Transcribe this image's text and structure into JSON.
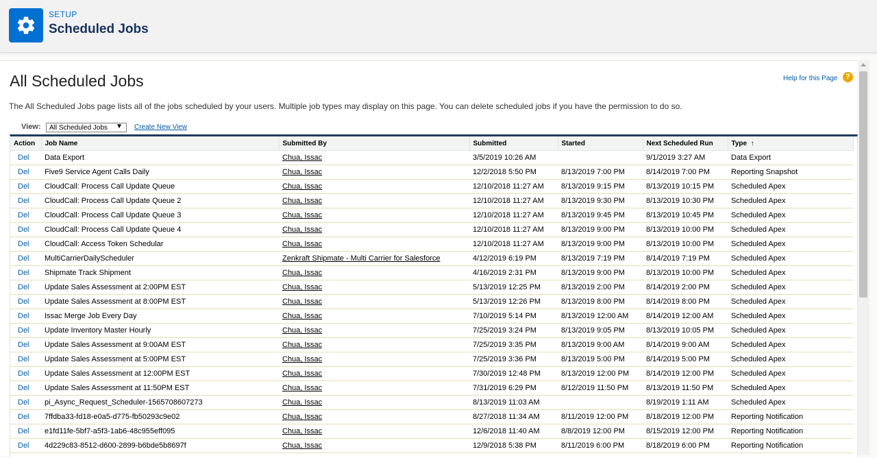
{
  "header": {
    "eyebrow": "SETUP",
    "title": "Scheduled Jobs"
  },
  "page": {
    "title": "All Scheduled Jobs",
    "help_link": "Help for this Page",
    "help_icon": "?",
    "description": "The All Scheduled Jobs page lists all of the jobs scheduled by your users. Multiple job types may display on this page. You can delete scheduled jobs if you have the permission to do so."
  },
  "view": {
    "label": "View:",
    "selected": "All Scheduled Jobs",
    "create_link": "Create New View"
  },
  "table": {
    "columns": {
      "action": "Action",
      "job_name": "Job Name",
      "submitted_by": "Submitted By",
      "submitted": "Submitted",
      "started": "Started",
      "next_run": "Next Scheduled Run",
      "type": "Type",
      "sort_indicator": "↑"
    },
    "rows": [
      {
        "action": "Del",
        "job_name": "Data Export",
        "submitted_by": "Chua, Issac",
        "submitted": "3/5/2019 10:26 AM",
        "started": "",
        "next_run": "9/1/2019 3:27 AM",
        "type": "Data Export"
      },
      {
        "action": "Del",
        "job_name": "Five9 Service Agent Calls Daily",
        "submitted_by": "Chua, Issac",
        "submitted": "12/2/2018 5:50 PM",
        "started": "8/13/2019 7:00 PM",
        "next_run": "8/14/2019 7:00 PM",
        "type": "Reporting Snapshot"
      },
      {
        "action": "Del",
        "job_name": "CloudCall: Process Call Update Queue",
        "submitted_by": "Chua, Issac",
        "submitted": "12/10/2018 11:27 AM",
        "started": "8/13/2019 9:15 PM",
        "next_run": "8/13/2019 10:15 PM",
        "type": "Scheduled Apex"
      },
      {
        "action": "Del",
        "job_name": "CloudCall: Process Call Update Queue 2",
        "submitted_by": "Chua, Issac",
        "submitted": "12/10/2018 11:27 AM",
        "started": "8/13/2019 9:30 PM",
        "next_run": "8/13/2019 10:30 PM",
        "type": "Scheduled Apex"
      },
      {
        "action": "Del",
        "job_name": "CloudCall: Process Call Update Queue 3",
        "submitted_by": "Chua, Issac",
        "submitted": "12/10/2018 11:27 AM",
        "started": "8/13/2019 9:45 PM",
        "next_run": "8/13/2019 10:45 PM",
        "type": "Scheduled Apex"
      },
      {
        "action": "Del",
        "job_name": "CloudCall: Process Call Update Queue 4",
        "submitted_by": "Chua, Issac",
        "submitted": "12/10/2018 11:27 AM",
        "started": "8/13/2019 9:00 PM",
        "next_run": "8/13/2019 10:00 PM",
        "type": "Scheduled Apex"
      },
      {
        "action": "Del",
        "job_name": "CloudCall: Access Token Schedular",
        "submitted_by": "Chua, Issac",
        "submitted": "12/10/2018 11:27 AM",
        "started": "8/13/2019 9:00 PM",
        "next_run": "8/13/2019 10:00 PM",
        "type": "Scheduled Apex"
      },
      {
        "action": "Del",
        "job_name": "MultiCarrierDailyScheduler",
        "submitted_by": "Zenkraft Shipmate - Multi Carrier for Salesforce",
        "submitted": "4/12/2019 6:19 PM",
        "started": "8/13/2019 7:19 PM",
        "next_run": "8/14/2019 7:19 PM",
        "type": "Scheduled Apex"
      },
      {
        "action": "Del",
        "job_name": "Shipmate Track Shipment",
        "submitted_by": "Chua, Issac",
        "submitted": "4/16/2019 2:31 PM",
        "started": "8/13/2019 9:00 PM",
        "next_run": "8/13/2019 10:00 PM",
        "type": "Scheduled Apex"
      },
      {
        "action": "Del",
        "job_name": "Update Sales Assessment at 2:00PM EST",
        "submitted_by": "Chua, Issac",
        "submitted": "5/13/2019 12:25 PM",
        "started": "8/13/2019 2:00 PM",
        "next_run": "8/14/2019 2:00 PM",
        "type": "Scheduled Apex"
      },
      {
        "action": "Del",
        "job_name": "Update Sales Assessment at 8:00PM EST",
        "submitted_by": "Chua, Issac",
        "submitted": "5/13/2019 12:26 PM",
        "started": "8/13/2019 8:00 PM",
        "next_run": "8/14/2019 8:00 PM",
        "type": "Scheduled Apex"
      },
      {
        "action": "Del",
        "job_name": "Issac Merge Job Every Day",
        "submitted_by": "Chua, Issac",
        "submitted": "7/10/2019 5:14 PM",
        "started": "8/13/2019 12:00 AM",
        "next_run": "8/14/2019 12:00 AM",
        "type": "Scheduled Apex"
      },
      {
        "action": "Del",
        "job_name": "Update Inventory Master Hourly",
        "submitted_by": "Chua, Issac",
        "submitted": "7/25/2019 3:24 PM",
        "started": "8/13/2019 9:05 PM",
        "next_run": "8/13/2019 10:05 PM",
        "type": "Scheduled Apex"
      },
      {
        "action": "Del",
        "job_name": "Update Sales Assessment at 9:00AM EST",
        "submitted_by": "Chua, Issac",
        "submitted": "7/25/2019 3:35 PM",
        "started": "8/13/2019 9:00 AM",
        "next_run": "8/14/2019 9:00 AM",
        "type": "Scheduled Apex"
      },
      {
        "action": "Del",
        "job_name": "Update Sales Assessment at 5:00PM EST",
        "submitted_by": "Chua, Issac",
        "submitted": "7/25/2019 3:36 PM",
        "started": "8/13/2019 5:00 PM",
        "next_run": "8/14/2019 5:00 PM",
        "type": "Scheduled Apex"
      },
      {
        "action": "Del",
        "job_name": "Update Sales Assessment at 12:00PM EST",
        "submitted_by": "Chua, Issac",
        "submitted": "7/30/2019 12:48 PM",
        "started": "8/13/2019 12:00 PM",
        "next_run": "8/14/2019 12:00 PM",
        "type": "Scheduled Apex"
      },
      {
        "action": "Del",
        "job_name": "Update Sales Assessment at 11:50PM EST",
        "submitted_by": "Chua, Issac",
        "submitted": "7/31/2019 6:29 PM",
        "started": "8/12/2019 11:50 PM",
        "next_run": "8/13/2019 11:50 PM",
        "type": "Scheduled Apex"
      },
      {
        "action": "Del",
        "job_name": "pi_Async_Request_Scheduler-1565708607273",
        "submitted_by": "Chua, Issac",
        "submitted": "8/13/2019 11:03 AM",
        "started": "",
        "next_run": "8/19/2019 1:11 AM",
        "type": "Scheduled Apex"
      },
      {
        "action": "Del",
        "job_name": "7ffdba33-fd18-e0a5-d775-fb50293c9e02",
        "submitted_by": "Chua, Issac",
        "submitted": "8/27/2018 11:34 AM",
        "started": "8/11/2019 12:00 PM",
        "next_run": "8/18/2019 12:00 PM",
        "type": "Reporting Notification"
      },
      {
        "action": "Del",
        "job_name": "e1fd11fe-5bf7-a5f3-1ab6-48c955eff095",
        "submitted_by": "Chua, Issac",
        "submitted": "12/6/2018 11:40 AM",
        "started": "8/8/2019 12:00 PM",
        "next_run": "8/15/2019 12:00 PM",
        "type": "Reporting Notification"
      },
      {
        "action": "Del",
        "job_name": "4d229c83-8512-d600-2899-b6bde5b8697f",
        "submitted_by": "Chua, Issac",
        "submitted": "12/9/2018 5:38 PM",
        "started": "8/11/2019 6:00 PM",
        "next_run": "8/18/2019 6:00 PM",
        "type": "Reporting Notification"
      }
    ]
  }
}
